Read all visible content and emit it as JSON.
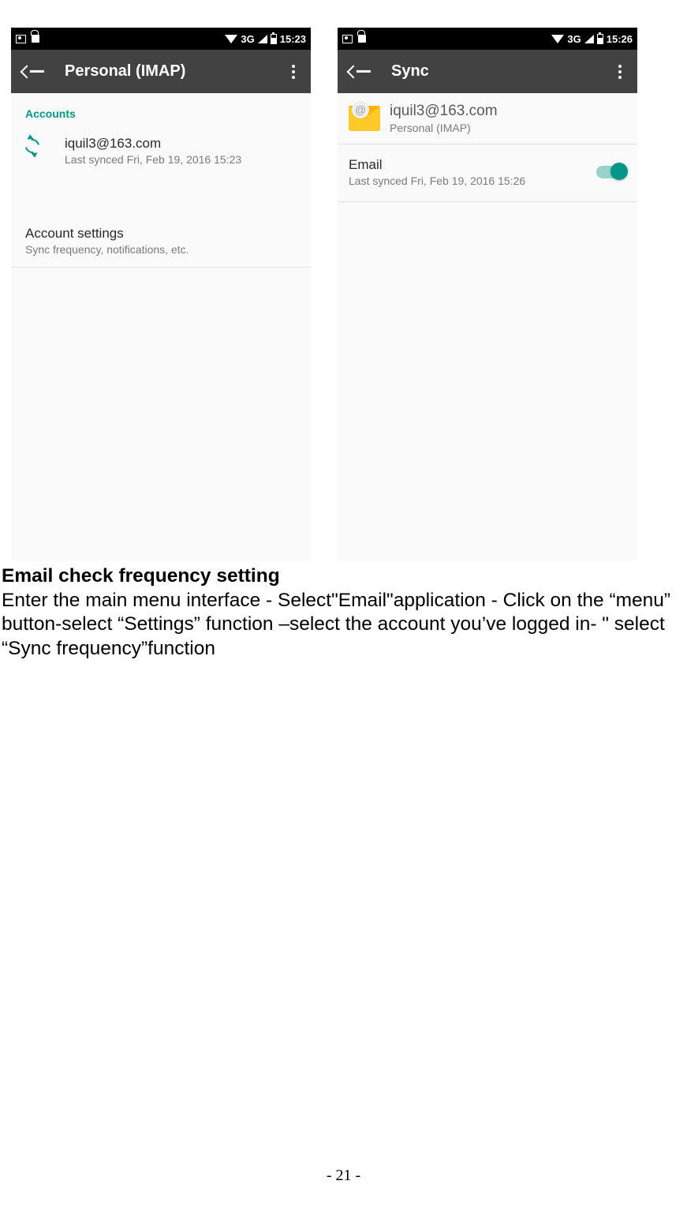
{
  "screen1": {
    "status": {
      "network": "3G",
      "time": "15:23"
    },
    "appbar": {
      "title": "Personal (IMAP)"
    },
    "accountsHeader": "Accounts",
    "account": {
      "email": "iquil3@163.com",
      "lastSynced": "Last synced Fri, Feb 19, 2016 15:23"
    },
    "settings": {
      "title": "Account settings",
      "sub": "Sync frequency, notifications, etc."
    }
  },
  "screen2": {
    "status": {
      "network": "3G",
      "time": "15:26"
    },
    "appbar": {
      "title": "Sync"
    },
    "account": {
      "email": "iquil3@163.com",
      "type": "Personal (IMAP)"
    },
    "syncItem": {
      "title": "Email",
      "lastSynced": "Last synced Fri, Feb 19, 2016 15:26"
    }
  },
  "doc": {
    "heading": "Email check frequency setting",
    "body": "Enter the main menu interface - Select\"Email\"application - Click on the “menu” button-select “Settings” function –select the account you’ve logged in- \" select “Sync frequency”function",
    "pageNumber": "- 21 -"
  }
}
